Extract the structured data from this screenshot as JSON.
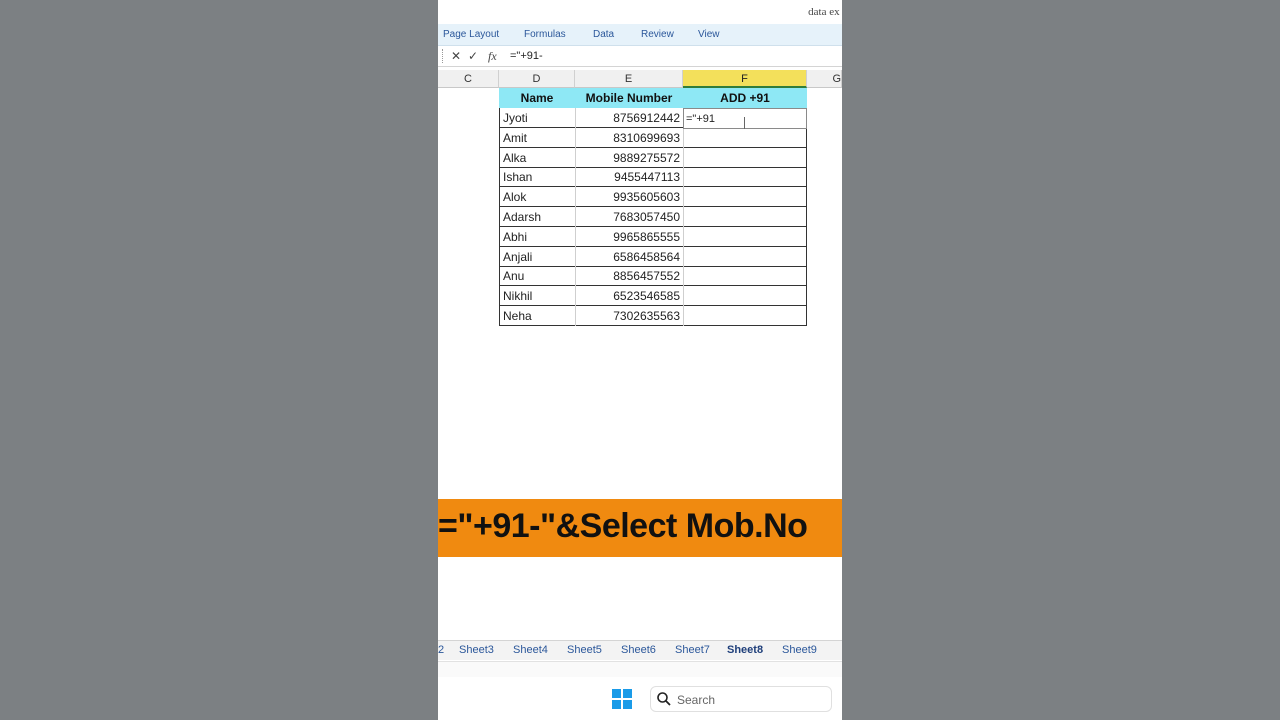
{
  "window": {
    "title": "data ex -"
  },
  "ribbon": {
    "tabs": [
      "Page Layout",
      "Formulas",
      "Data",
      "Review",
      "View"
    ]
  },
  "formula_bar": {
    "cancel": "✕",
    "enter": "✓",
    "fx": "fx",
    "content": "=\"+91-"
  },
  "columns": [
    "C",
    "D",
    "E",
    "F",
    "G"
  ],
  "table": {
    "headers": [
      "Name",
      "Mobile Number",
      "ADD +91"
    ],
    "rows": [
      {
        "name": "Jyoti",
        "mobile": "8756912442"
      },
      {
        "name": "Amit",
        "mobile": "8310699693"
      },
      {
        "name": "Alka",
        "mobile": "9889275572"
      },
      {
        "name": "Ishan",
        "mobile": "9455447113"
      },
      {
        "name": "Alok",
        "mobile": "9935605603"
      },
      {
        "name": "Adarsh",
        "mobile": "7683057450"
      },
      {
        "name": "Abhi",
        "mobile": "9965865555"
      },
      {
        "name": "Anjali",
        "mobile": "6586458564"
      },
      {
        "name": "Anu",
        "mobile": "8856457552"
      },
      {
        "name": "Nikhil",
        "mobile": "6523546585"
      },
      {
        "name": "Neha",
        "mobile": "7302635563"
      }
    ],
    "active_cell_value": "=\"+91"
  },
  "banner": {
    "text": "=\"+91-\"&Select Mob.No"
  },
  "sheets": [
    "2",
    "Sheet3",
    "Sheet4",
    "Sheet5",
    "Sheet6",
    "Sheet7",
    "Sheet8",
    "Sheet9"
  ],
  "active_sheet": "Sheet8",
  "taskbar": {
    "search_placeholder": "Search"
  },
  "colors": {
    "header_fill": "#8ee8f5",
    "banner": "#f08a10",
    "ribbon_text": "#2b579a",
    "selected_col": "#f3e05b"
  }
}
